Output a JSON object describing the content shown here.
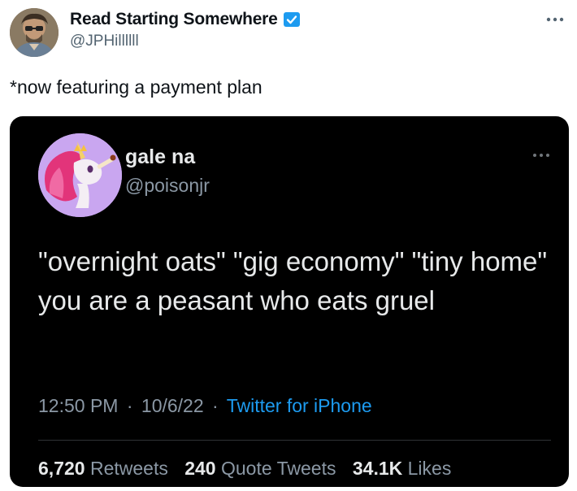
{
  "author": {
    "name": "Read Starting Somewhere",
    "handle": "@JPHillllll",
    "verified": true,
    "verified_color": "#1d9bf0"
  },
  "tweet": {
    "text": "*now featuring a payment plan"
  },
  "embedded": {
    "name": "gale na",
    "handle": "@poisonjr",
    "text": "\"overnight oats\" \"gig economy\" \"tiny home\" you are a peasant who eats gruel",
    "time": "12:50 PM",
    "date": "10/6/22",
    "separator": "·",
    "source": "Twitter for iPhone",
    "source_color": "#1d9bf0",
    "stats": {
      "retweets_count": "6,720",
      "retweets_label": "Retweets",
      "quotes_count": "240",
      "quotes_label": "Quote Tweets",
      "likes_count": "34.1K",
      "likes_label": "Likes"
    }
  },
  "icons": {
    "more": "more-icon",
    "verified": "verified-icon"
  }
}
